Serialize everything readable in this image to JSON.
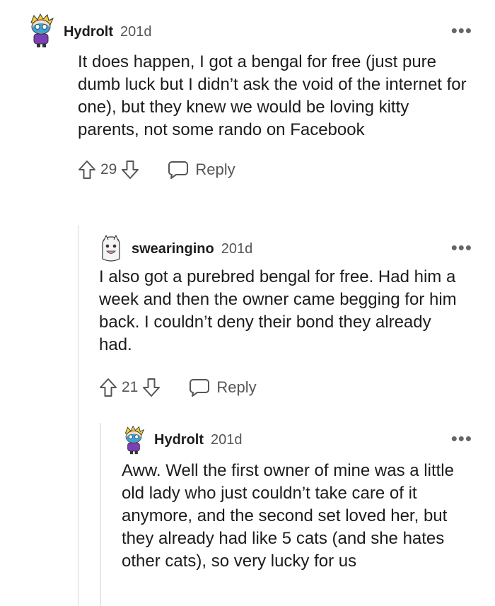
{
  "comments": [
    {
      "username": "Hydrolt",
      "age": "201d",
      "text": "It does happen, I got a bengal for free (just pure dumb luck but I didn’t ask the void of the internet for one), but they knew we would be loving kitty parents, not some rando on Facebook",
      "score": "29",
      "reply_label": "Reply",
      "more_label": "•••"
    },
    {
      "username": "swearingino",
      "age": "201d",
      "text": "I also got a purebred bengal for free. Had him a week and then the owner came begging for him back. I couldn’t deny their bond they already had.",
      "score": "21",
      "reply_label": "Reply",
      "more_label": "•••"
    },
    {
      "username": "Hydrolt",
      "age": "201d",
      "text": "Aww. Well the first owner of mine was a little old lady who just couldn’t take care of it anymore, and the second set loved her, but they already had like 5 cats (and she hates other cats), so very lucky for us",
      "more_label": "•••"
    }
  ],
  "icons": {
    "upvote": "arrow-up-outline",
    "downvote": "arrow-down-outline",
    "reply": "speech-bubble-outline",
    "more": "horizontal-dots"
  },
  "colors": {
    "text": "#1c1c1c",
    "meta": "#555555",
    "thread_line": "#d6d6d6"
  }
}
